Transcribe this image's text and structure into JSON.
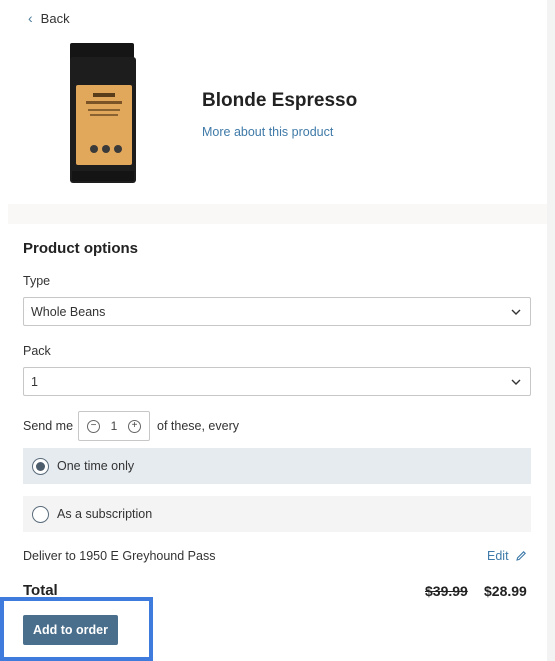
{
  "nav": {
    "back_label": "Back"
  },
  "product": {
    "name": "Blonde Espresso",
    "more_link": "More about this product",
    "bag_colors": {
      "bag": "#1d1d1d",
      "label": "#e1a75a"
    }
  },
  "options": {
    "section_title": "Product options",
    "type_label": "Type",
    "type_value": "Whole Beans",
    "pack_label": "Pack",
    "pack_value": "1"
  },
  "frequency": {
    "send_me_label": "Send me",
    "quantity": "1",
    "of_these_label": "of these, every",
    "options": [
      {
        "label": "One time only",
        "selected": true
      },
      {
        "label": "As a subscription",
        "selected": false
      }
    ]
  },
  "delivery": {
    "deliver_text": "Deliver to 1950 E Greyhound Pass",
    "edit_label": "Edit"
  },
  "total": {
    "label": "Total",
    "original_price": "$39.99",
    "sale_price": "$28.99"
  },
  "actions": {
    "add_to_order_label": "Add to order"
  },
  "colors": {
    "accent": "#3f7aa8",
    "button_bg": "#4a6f8c",
    "highlight_border": "#3e7bdc",
    "selected_row_bg": "#e6ebf0"
  }
}
